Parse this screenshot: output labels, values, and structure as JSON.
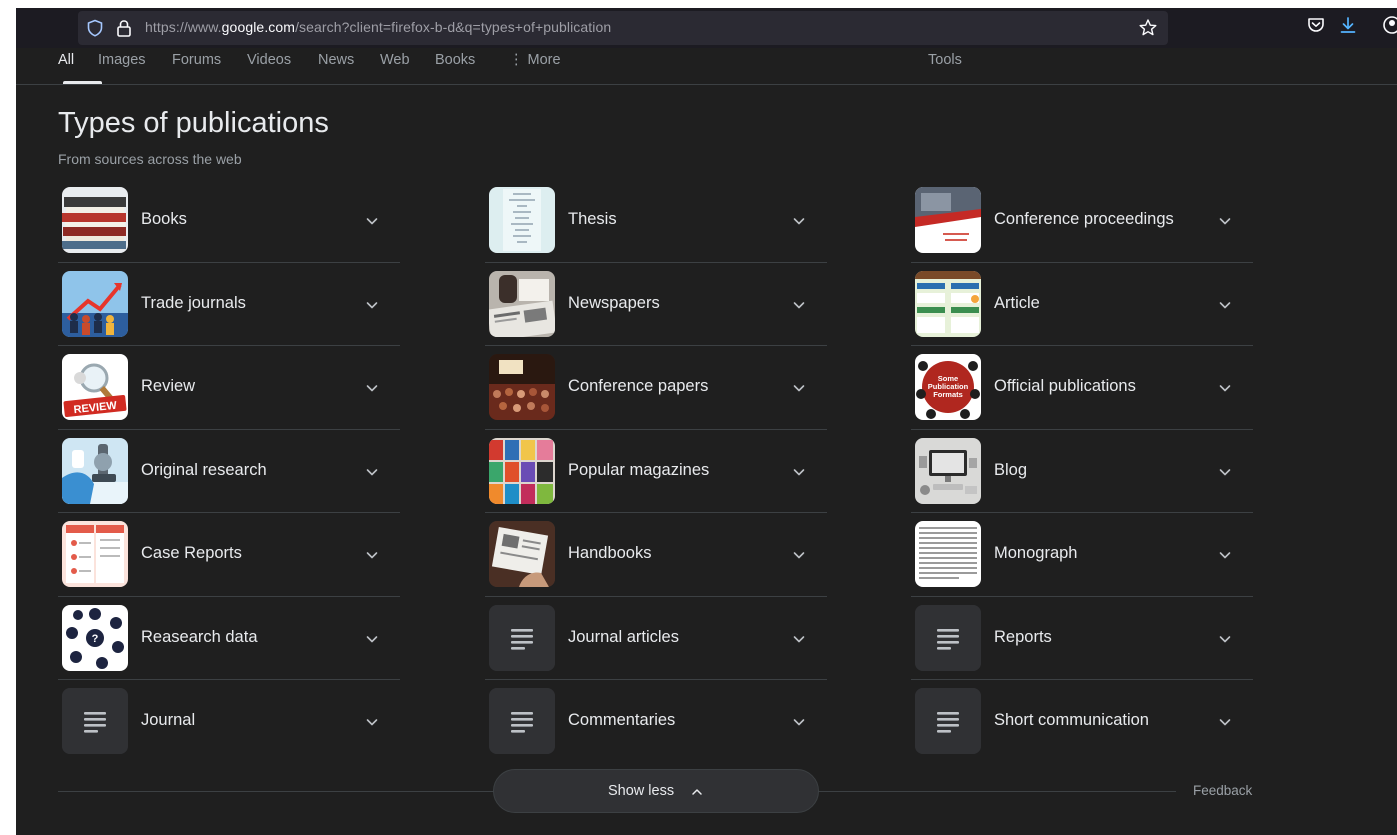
{
  "browser": {
    "url_prefix": "https://www.",
    "url_domain": "google.com",
    "url_rest": "/search?client=firefox-b-d&q=types+of+publication"
  },
  "tabs": [
    {
      "label": "All",
      "active": true
    },
    {
      "label": "Images"
    },
    {
      "label": "Forums"
    },
    {
      "label": "Videos"
    },
    {
      "label": "News"
    },
    {
      "label": "Web"
    },
    {
      "label": "Books"
    },
    {
      "label": "⋮ More"
    },
    {
      "label": "Tools"
    }
  ],
  "panel": {
    "title": "Types of publications",
    "subtitle": "From sources across the web"
  },
  "columns": [
    {
      "items": [
        {
          "label": "Books",
          "thumb": "books-photo"
        },
        {
          "label": "Trade journals",
          "thumb": "trade-journals-photo"
        },
        {
          "label": "Review",
          "thumb": "review-photo"
        },
        {
          "label": "Original research",
          "thumb": "lab-photo"
        },
        {
          "label": "Case Reports",
          "thumb": "case-report-photo"
        },
        {
          "label": "Reasearch data",
          "thumb": "research-data-diagram"
        },
        {
          "label": "Journal",
          "thumb": "document-icon"
        }
      ]
    },
    {
      "items": [
        {
          "label": "Thesis",
          "thumb": "thesis-page"
        },
        {
          "label": "Newspapers",
          "thumb": "newspapers-photo"
        },
        {
          "label": "Conference papers",
          "thumb": "conference-photo"
        },
        {
          "label": "Popular magazines",
          "thumb": "magazines-photo"
        },
        {
          "label": "Handbooks",
          "thumb": "handbook-photo"
        },
        {
          "label": "Journal articles",
          "thumb": "document-icon"
        },
        {
          "label": "Commentaries",
          "thumb": "document-icon"
        }
      ]
    },
    {
      "items": [
        {
          "label": "Conference proceedings",
          "thumb": "proceedings-cover"
        },
        {
          "label": "Article",
          "thumb": "article-infographic"
        },
        {
          "label": "Official publications",
          "thumb": "publication-formats-graphic",
          "thumb_text": [
            "Some",
            "Publication",
            "Formats"
          ]
        },
        {
          "label": "Blog",
          "thumb": "blog-desk-photo"
        },
        {
          "label": "Monograph",
          "thumb": "monograph-page"
        },
        {
          "label": "Reports",
          "thumb": "document-icon"
        },
        {
          "label": "Short communication",
          "thumb": "document-icon"
        }
      ]
    }
  ],
  "footer": {
    "show_less_label": "Show less",
    "feedback_label": "Feedback"
  },
  "colors": {
    "background": "#1f1f1f",
    "text": "#e8eaed",
    "muted": "#9aa0a6",
    "divider": "#3c4043",
    "download_accent": "#54b4ff"
  }
}
